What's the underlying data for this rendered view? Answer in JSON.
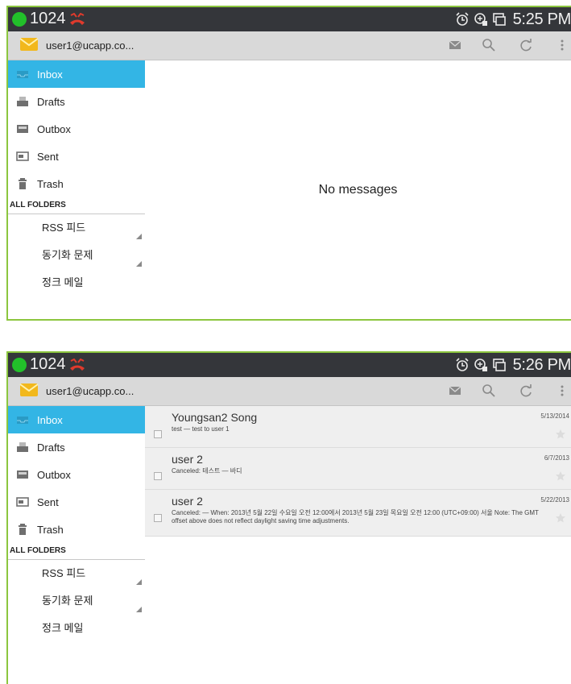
{
  "colors": {
    "accent": "#33b5e5",
    "statusbar": "#34363a",
    "frame": "#8cc63f",
    "online": "#22c02a"
  },
  "screens": [
    {
      "status": {
        "count": "1024",
        "time": "5:25 PM"
      },
      "account": "user1@ucapp.co...",
      "nav": [
        "Inbox",
        "Drafts",
        "Outbox",
        "Sent",
        "Trash"
      ],
      "all_folders": "ALL FOLDERS",
      "folders": [
        "RSS 피드",
        "동기화 문제",
        "정크 메일"
      ],
      "empty_text": "No messages"
    },
    {
      "status": {
        "count": "1024",
        "time": "5:26 PM"
      },
      "account": "user1@ucapp.co...",
      "nav": [
        "Inbox",
        "Drafts",
        "Outbox",
        "Sent",
        "Trash"
      ],
      "all_folders": "ALL FOLDERS",
      "folders": [
        "RSS 피드",
        "동기화 문제",
        "정크 메일"
      ],
      "messages": [
        {
          "sender": "Youngsan2 Song",
          "date": "5/13/2014",
          "preview": "test — test to user 1"
        },
        {
          "sender": "user 2",
          "date": "6/7/2013",
          "preview": "Canceled: 테스트 — 바디"
        },
        {
          "sender": "user 2",
          "date": "5/22/2013",
          "preview": "Canceled:  — When: 2013년 5월 22일 수요일 오전 12:00에서 2013년 5월 23일 목요일 오전 12:00 (UTC+09:00) 서울 Note: The GMT offset above does not reflect daylight saving time adjustments."
        }
      ]
    }
  ],
  "icons": {
    "status": [
      "online-dot-icon",
      "missed-call-icon",
      "alarm-icon",
      "sync-icon",
      "screen-icon"
    ],
    "actions": [
      "compose-icon",
      "search-icon",
      "refresh-icon",
      "overflow-menu-icon"
    ],
    "nav": [
      "inbox-icon",
      "drafts-icon",
      "outbox-icon",
      "sent-icon",
      "trash-icon"
    ],
    "message": [
      "checkbox-icon",
      "star-icon"
    ]
  }
}
